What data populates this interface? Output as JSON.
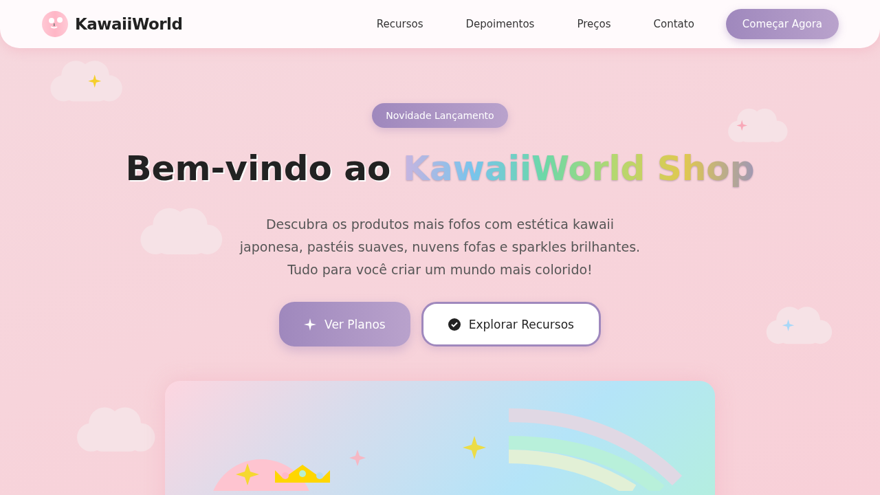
{
  "header": {
    "brand": "KawaiiWorld",
    "nav": [
      "Recursos",
      "Depoimentos",
      "Preços",
      "Contato"
    ],
    "cta": "Começar Agora"
  },
  "hero": {
    "badge": "Novidade Lançamento",
    "title": "Bem-vindo ao",
    "title_highlight": "KawaiiWorld Shop",
    "description": "Descubra os produtos mais fofos com estética kawaii japonesa, pastéis suaves, nuvens fofas e sparkles brilhantes. Tudo para você criar um mundo mais colorido!",
    "buttons": [
      {
        "label": "Ver Planos",
        "kind": "primary"
      },
      {
        "label": "Explorar Recursos",
        "kind": "secondary"
      }
    ]
  }
}
